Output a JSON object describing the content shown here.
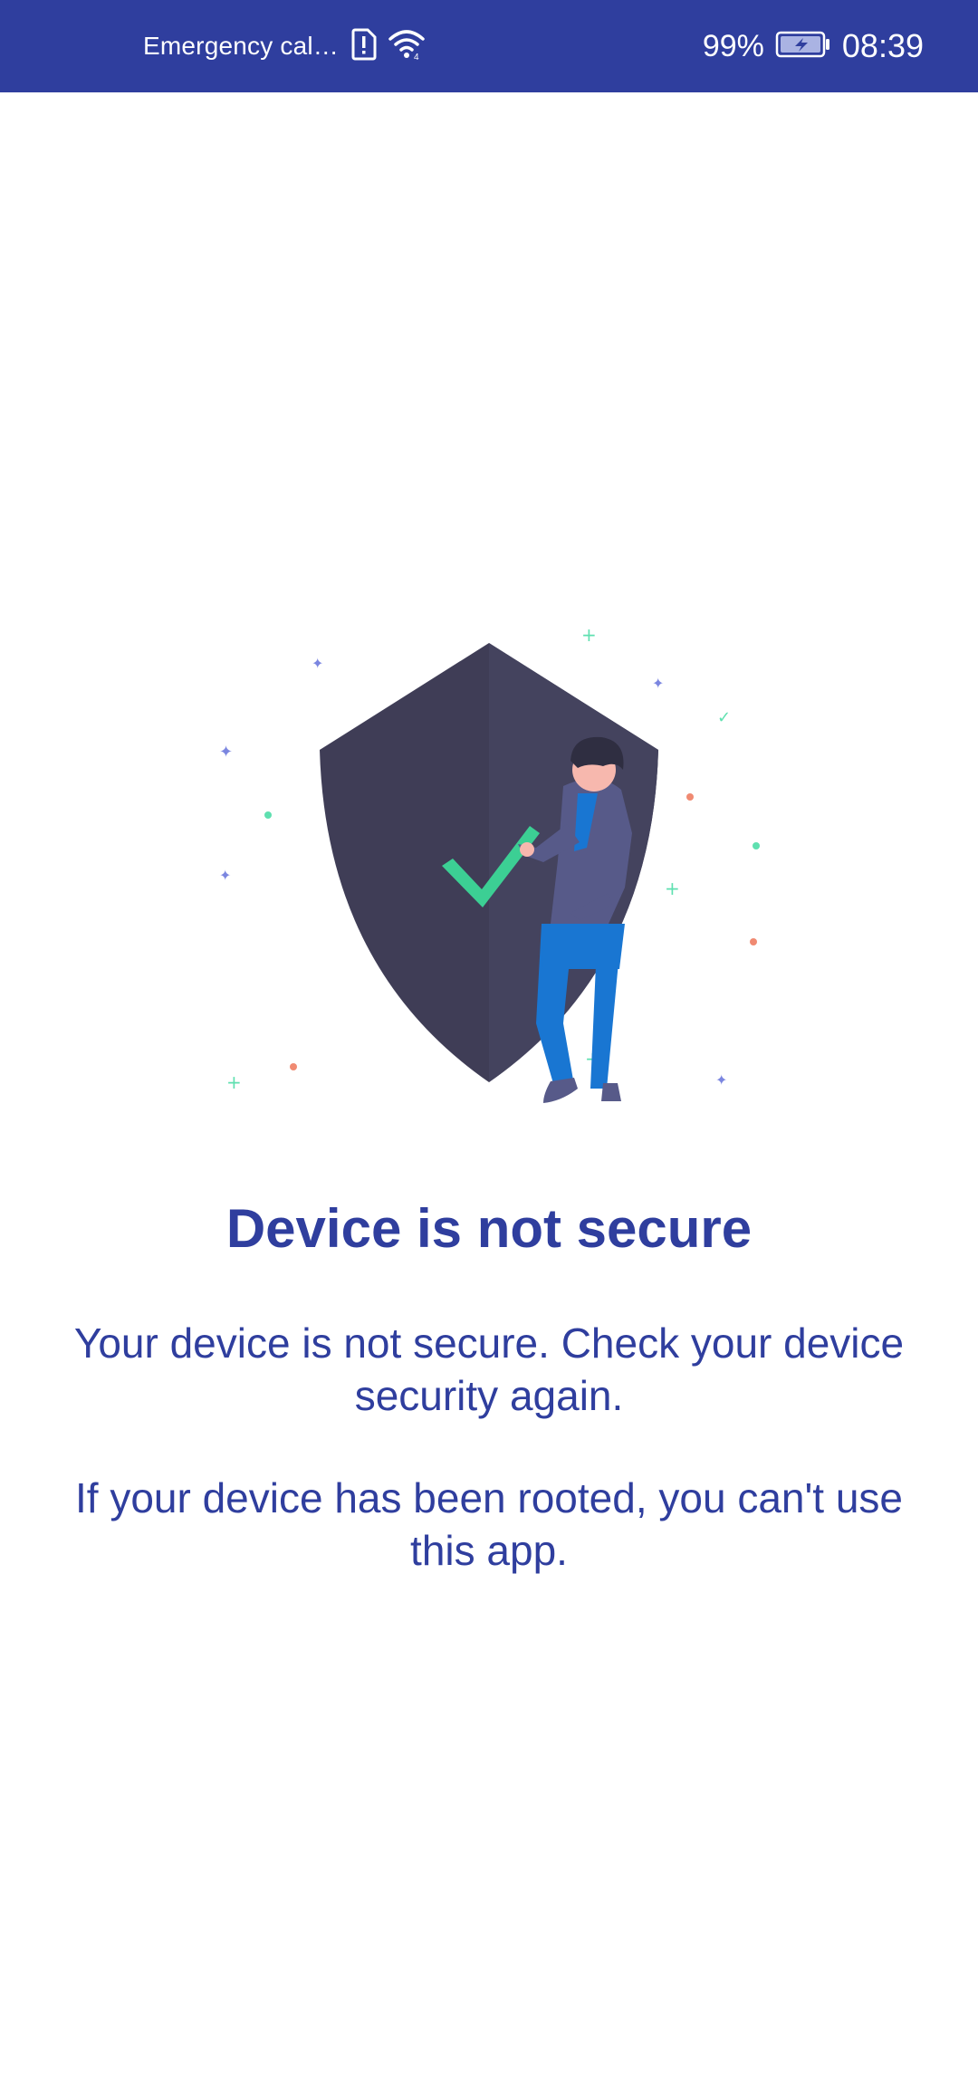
{
  "status_bar": {
    "carrier_text": "Emergency cal…",
    "sim_icon": "sim-alert-icon",
    "wifi_icon": "wifi-icon",
    "battery_percent": "99%",
    "battery_icon": "battery-charging-icon",
    "time": "08:39",
    "background_color": "#2f3e9e"
  },
  "illustration": {
    "icon": "shield-check-person-illustration"
  },
  "content": {
    "title": "Device is not secure",
    "message_1": "Your device is not secure. Check your device security again.",
    "message_2": "If your device has been rooted, you can't use this app.",
    "text_color": "#2f3e9e"
  }
}
